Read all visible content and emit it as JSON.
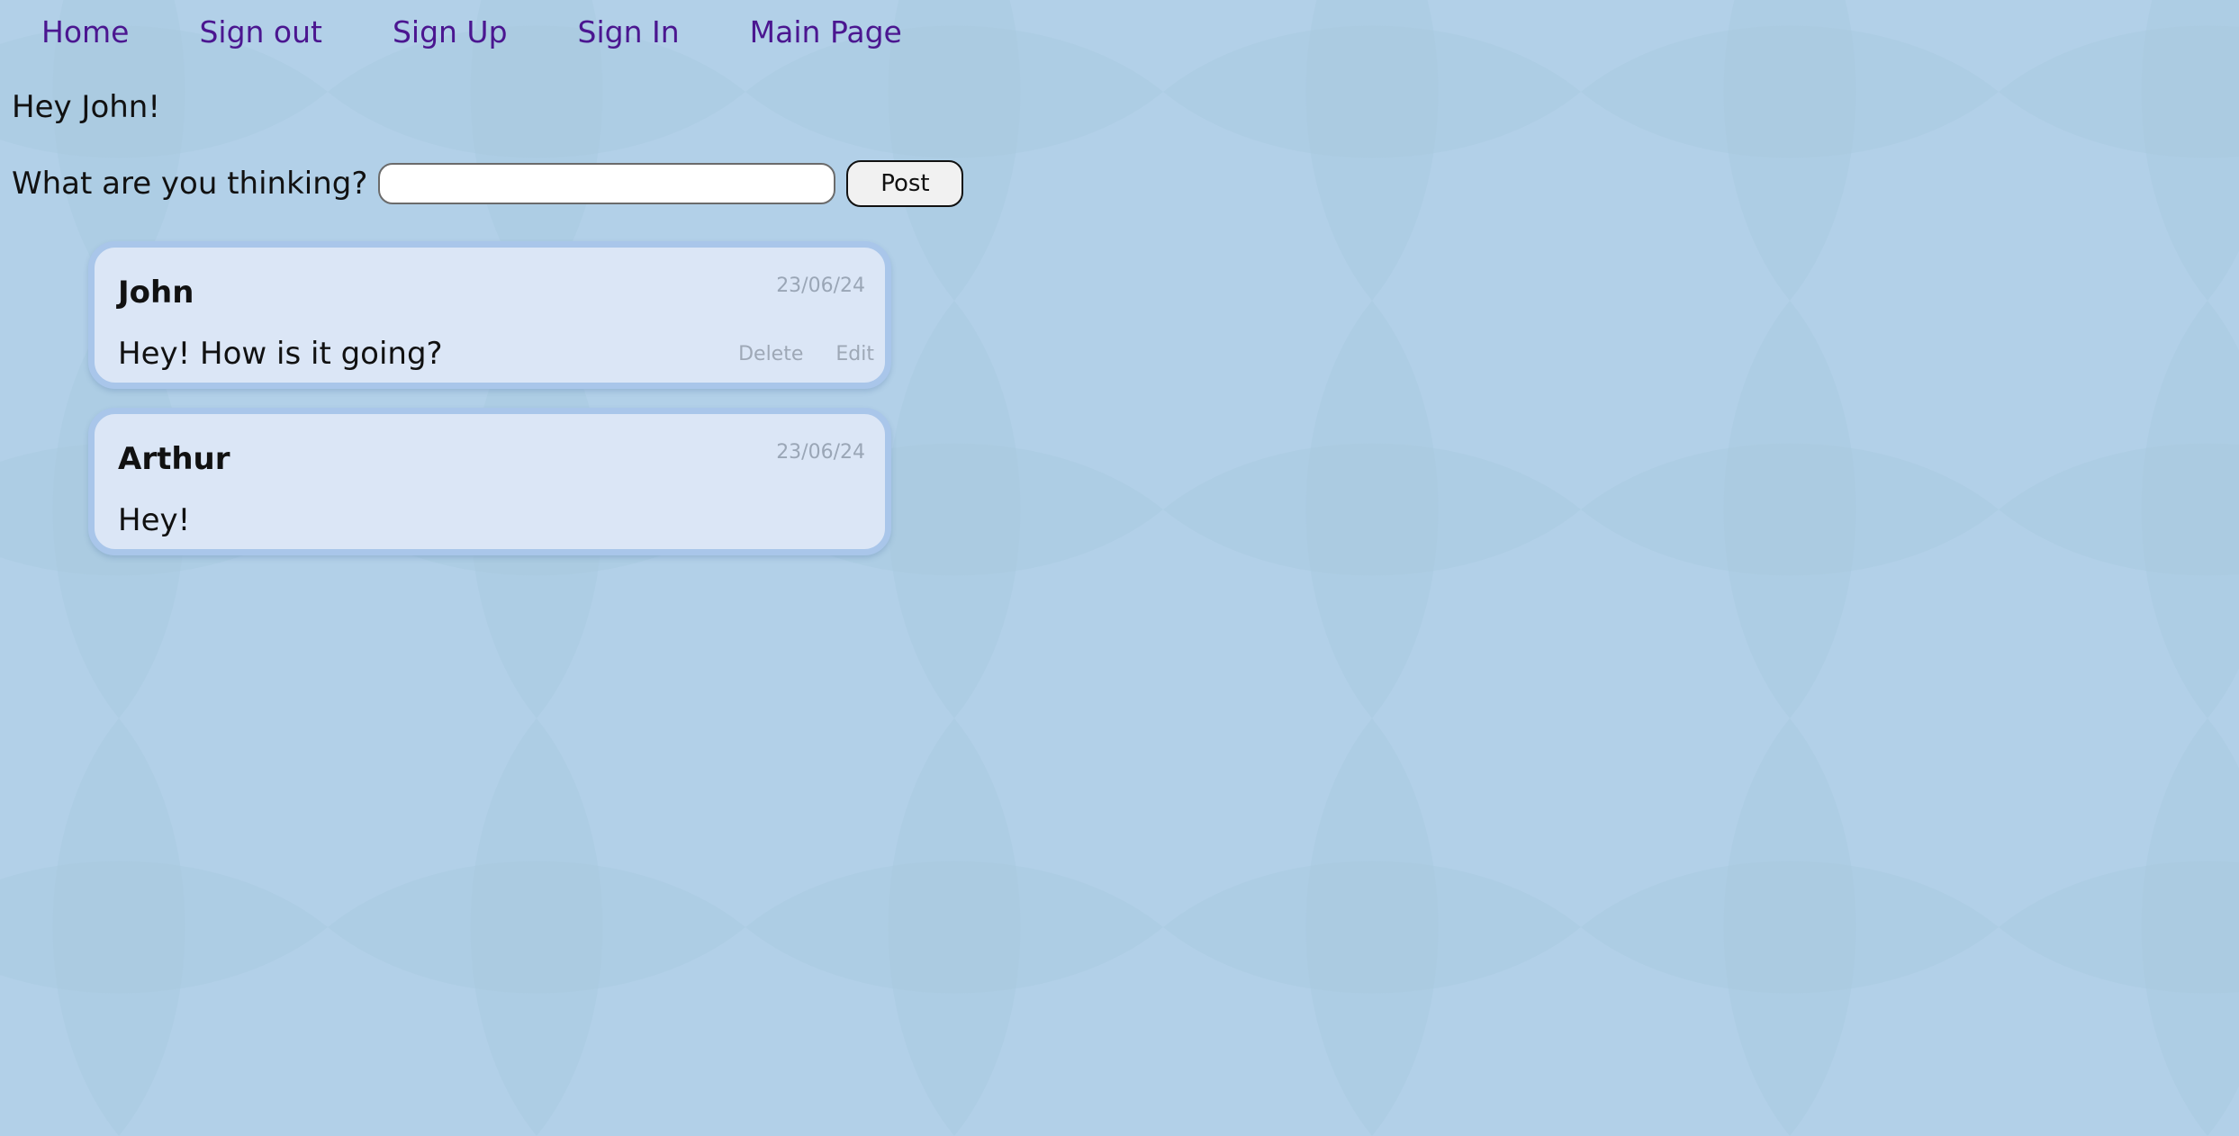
{
  "colors": {
    "background": "#b2d0e8",
    "nav_link": "#4b1690",
    "card_background": "#dbe6f6",
    "card_border": "#a9c6ea",
    "muted_text": "#9aa6b6"
  },
  "nav": {
    "items": [
      {
        "label": "Home"
      },
      {
        "label": "Sign out"
      },
      {
        "label": "Sign Up"
      },
      {
        "label": "Sign In"
      },
      {
        "label": "Main Page"
      }
    ]
  },
  "greeting": "Hey John!",
  "composer": {
    "label": "What are you thinking?",
    "value": "",
    "button_label": "Post"
  },
  "posts": [
    {
      "author": "John",
      "date": "23/06/24",
      "text": "Hey! How is it going?",
      "delete_label": "Delete",
      "edit_label": "Edit"
    },
    {
      "author": "Arthur",
      "date": "23/06/24",
      "text": "Hey!"
    }
  ]
}
